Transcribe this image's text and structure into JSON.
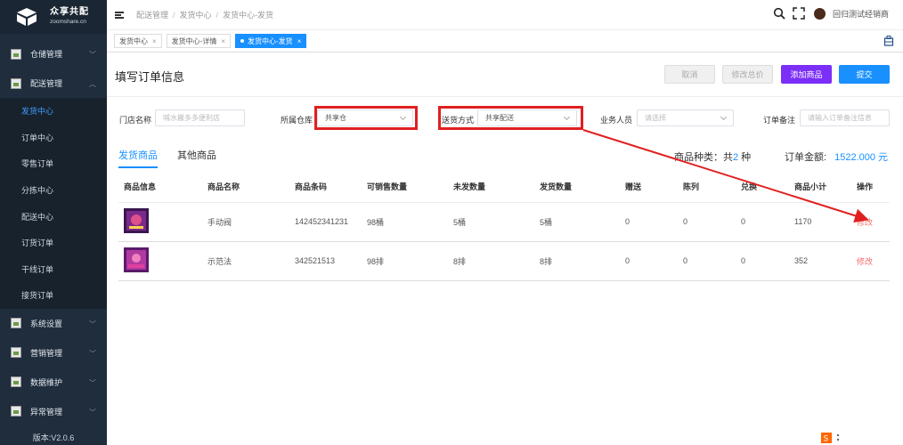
{
  "brand": {
    "name": "众享共配",
    "domain": "zoomshare.cn"
  },
  "sidebar": {
    "groups_top": [
      {
        "label": "仓储管理",
        "expanded": false
      },
      {
        "label": "配送管理",
        "expanded": true
      }
    ],
    "sub_items": [
      "发货中心",
      "订单中心",
      "零售订单",
      "分拣中心",
      "配送中心",
      "订货订单",
      "干线订单",
      "接货订单"
    ],
    "active_sub": "发货中心",
    "groups_bottom": [
      "系统设置",
      "营销管理",
      "数据维护",
      "异常管理"
    ],
    "version": "版本:V2.0.6"
  },
  "topbar": {
    "breadcrumb": [
      "配送管理",
      "发货中心",
      "发货中心-发货"
    ],
    "user": "回归测试经销商"
  },
  "tabs": [
    {
      "label": "发货中心",
      "active": false
    },
    {
      "label": "发货中心-详情",
      "active": false
    },
    {
      "label": "发货中心-发货",
      "active": true
    }
  ],
  "page": {
    "title": "填写订单信息",
    "buttons": {
      "cancel": "取消",
      "edit_total": "修改总价",
      "add_goods": "添加商品",
      "submit": "提交"
    }
  },
  "filters": {
    "store_label": "门店名称",
    "store_placeholder": "喊水搬多多便利店",
    "warehouse_label": "所属仓库",
    "warehouse_value": "共享仓",
    "delivery_label": "送货方式",
    "delivery_value": "共享配送",
    "sales_label": "业务人员",
    "sales_placeholder": "请选择",
    "remark_label": "订单备注",
    "remark_placeholder": "请输入订单备注信息"
  },
  "goods_tabs": [
    "发货商品",
    "其他商品"
  ],
  "summary": {
    "kinds_prefix": "商品种类：共",
    "kinds": "2",
    "kinds_suffix": " 种",
    "amount_label": "订单金额:",
    "amount": "1522.000 元"
  },
  "table": {
    "headers": [
      "商品信息",
      "商品名称",
      "商品条码",
      "可销售数量",
      "未发数量",
      "发货数量",
      "赠送",
      "陈列",
      "兑换",
      "商品小计",
      "操作"
    ],
    "rows": [
      {
        "name": "手动阀",
        "barcode": "142452341231",
        "sellable": "98桶",
        "unsent": "5桶",
        "send": "5桶",
        "gift": "0",
        "display": "0",
        "exchange": "0",
        "subtotal": "1170",
        "op": "修改"
      },
      {
        "name": "示范法",
        "barcode": "342521513",
        "sellable": "98排",
        "unsent": "8排",
        "send": "8排",
        "gift": "0",
        "display": "0",
        "exchange": "0",
        "subtotal": "352",
        "op": "修改"
      }
    ]
  },
  "colors": {
    "accent": "#1890ff",
    "purple": "#7b2ff7",
    "annotation": "#e02020",
    "sidebar": "#1f2d3d"
  }
}
